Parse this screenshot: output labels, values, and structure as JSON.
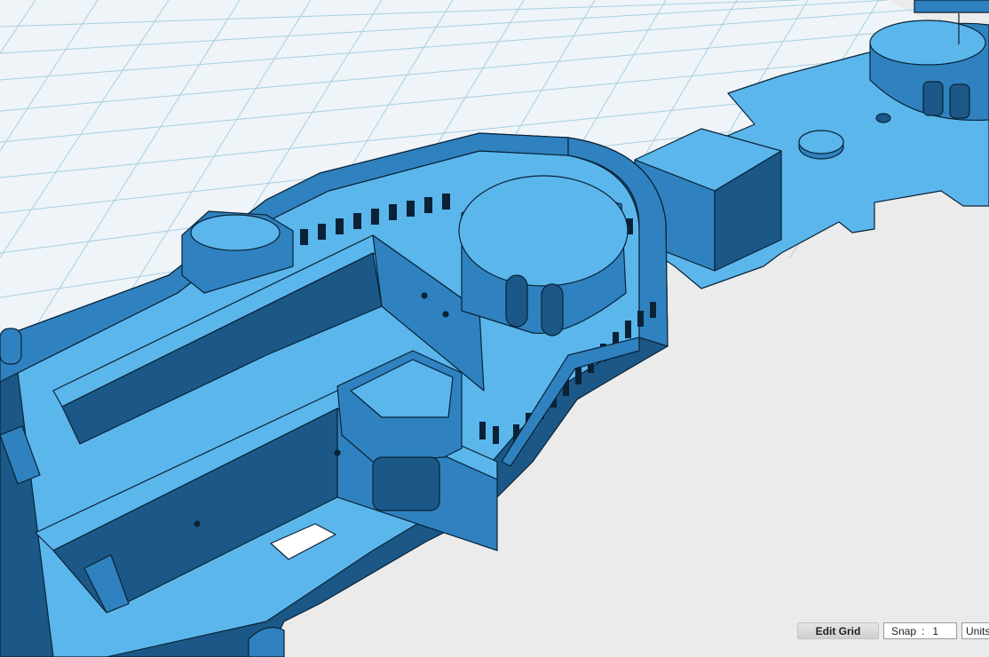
{
  "colors": {
    "background": "#ebebeb",
    "grid_plane": "#eef4f8",
    "grid_line": "#a9cfe0",
    "model_top": "#5bb6ec",
    "model_face": "#2f82bf",
    "model_dark": "#1b5887",
    "model_edge": "#0a2236"
  },
  "icons": {
    "model": "3d-ship-hull-model",
    "grid": "workplane-grid"
  },
  "toolbar": {
    "edit_grid_label": "Edit Grid",
    "snap_label": "Snap",
    "snap_separator": ":",
    "snap_value": "1",
    "units_label": "Units"
  }
}
